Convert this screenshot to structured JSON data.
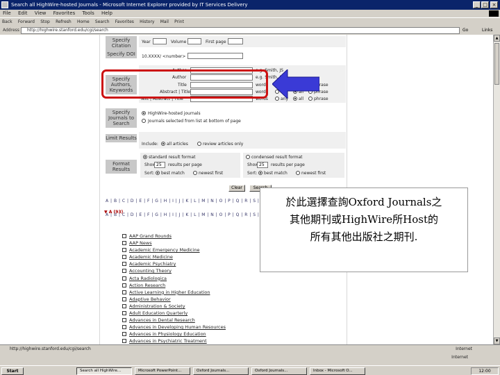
{
  "window": {
    "title": "Search all HighWire-hosted Journals - Microsoft Internet Explorer provided by IT Services Delivery",
    "controls": [
      "_",
      "□",
      "×"
    ]
  },
  "menu": [
    "File",
    "Edit",
    "View",
    "Favorites",
    "Tools",
    "Help"
  ],
  "toolbar": [
    "Back",
    "Forward",
    "Stop",
    "Refresh",
    "Home",
    "Search",
    "Favorites",
    "History",
    "Mail",
    "Print"
  ],
  "address": {
    "label": "Address",
    "url": "http://highwire.stanford.edu/cgi/search",
    "go": "Go",
    "links": "Links"
  },
  "form": {
    "citation": {
      "label": "Specify Citation",
      "year": "Year",
      "volume": "Volume",
      "first_page": "First page"
    },
    "doi": {
      "label": "Specify DOI",
      "prefix": "10.XXXX/ <number>"
    },
    "authors": {
      "label": "Specify Authors, Keywords",
      "fields": [
        "Author",
        "Author",
        "Title",
        "Abstract | Title",
        "Text | Abstract | Title"
      ],
      "example": "e.g. Smith, JS",
      "options": [
        "words",
        "any",
        "all",
        "phrase"
      ]
    },
    "journals": {
      "label": "Specify Journals to Search",
      "opt1": "HighWire-hosted journals",
      "opt2": "Journals selected from list at bottom of page"
    },
    "limit": {
      "label": "Limit Results",
      "include": "Include:",
      "opt1": "all articles",
      "opt2": "review articles only"
    },
    "format": {
      "label": "Format Results",
      "standard": "standard result format",
      "condensed": "condensed result format",
      "show": "Show",
      "per_page": "results per page",
      "per_page_value": "25",
      "sort": "Sort:",
      "best": "best match",
      "newest": "newest first"
    },
    "clear": "Clear",
    "search": "Search"
  },
  "alpha_rows": [
    "A | B | C | D | E | F | G | H | I | J | K | L | M | N | O | P | Q | R | S | T | U | V | W | X | Y | Z",
    "A | B | C | D | E | F | G | H | I | J | K | L | M | N | O | P | Q | R | S | T | U | V | W | X | Y | Z"
  ],
  "alpha_section": "▼ A (93)",
  "annotation": {
    "line1": "於此選擇查詢Oxford Journals之",
    "line2": "其他期刊或HighWire所Host的",
    "line3": "所有其他出版社之期刊."
  },
  "journals": [
    "AAP Grand Rounds",
    "AAP News",
    "Academic Emergency Medicine",
    "Academic Medicine",
    "Academic Psychiatry",
    "Accounting Theory",
    "Acta Radiologica",
    "Action Research",
    "Active Learning in Higher Education",
    "Adaptive Behavior",
    "Administration & Society",
    "Adult Education Quarterly",
    "Advances in Dental Research",
    "Advances in Developing Human Resources",
    "Advances in Physiology Education",
    "Advances in Psychiatric Treatment"
  ],
  "status": {
    "text": "http://highwire.stanford.edu/cgi/search",
    "zone": "Internet",
    "progress_zone": "Internet"
  },
  "taskbar": {
    "start": "Start",
    "tasks": [
      "Search all HighWire...",
      "Microsoft PowerPoint...",
      "Oxford Journals...",
      "Oxford Journals...",
      "Inbox - Microsoft O..."
    ],
    "clock": "12:00"
  }
}
